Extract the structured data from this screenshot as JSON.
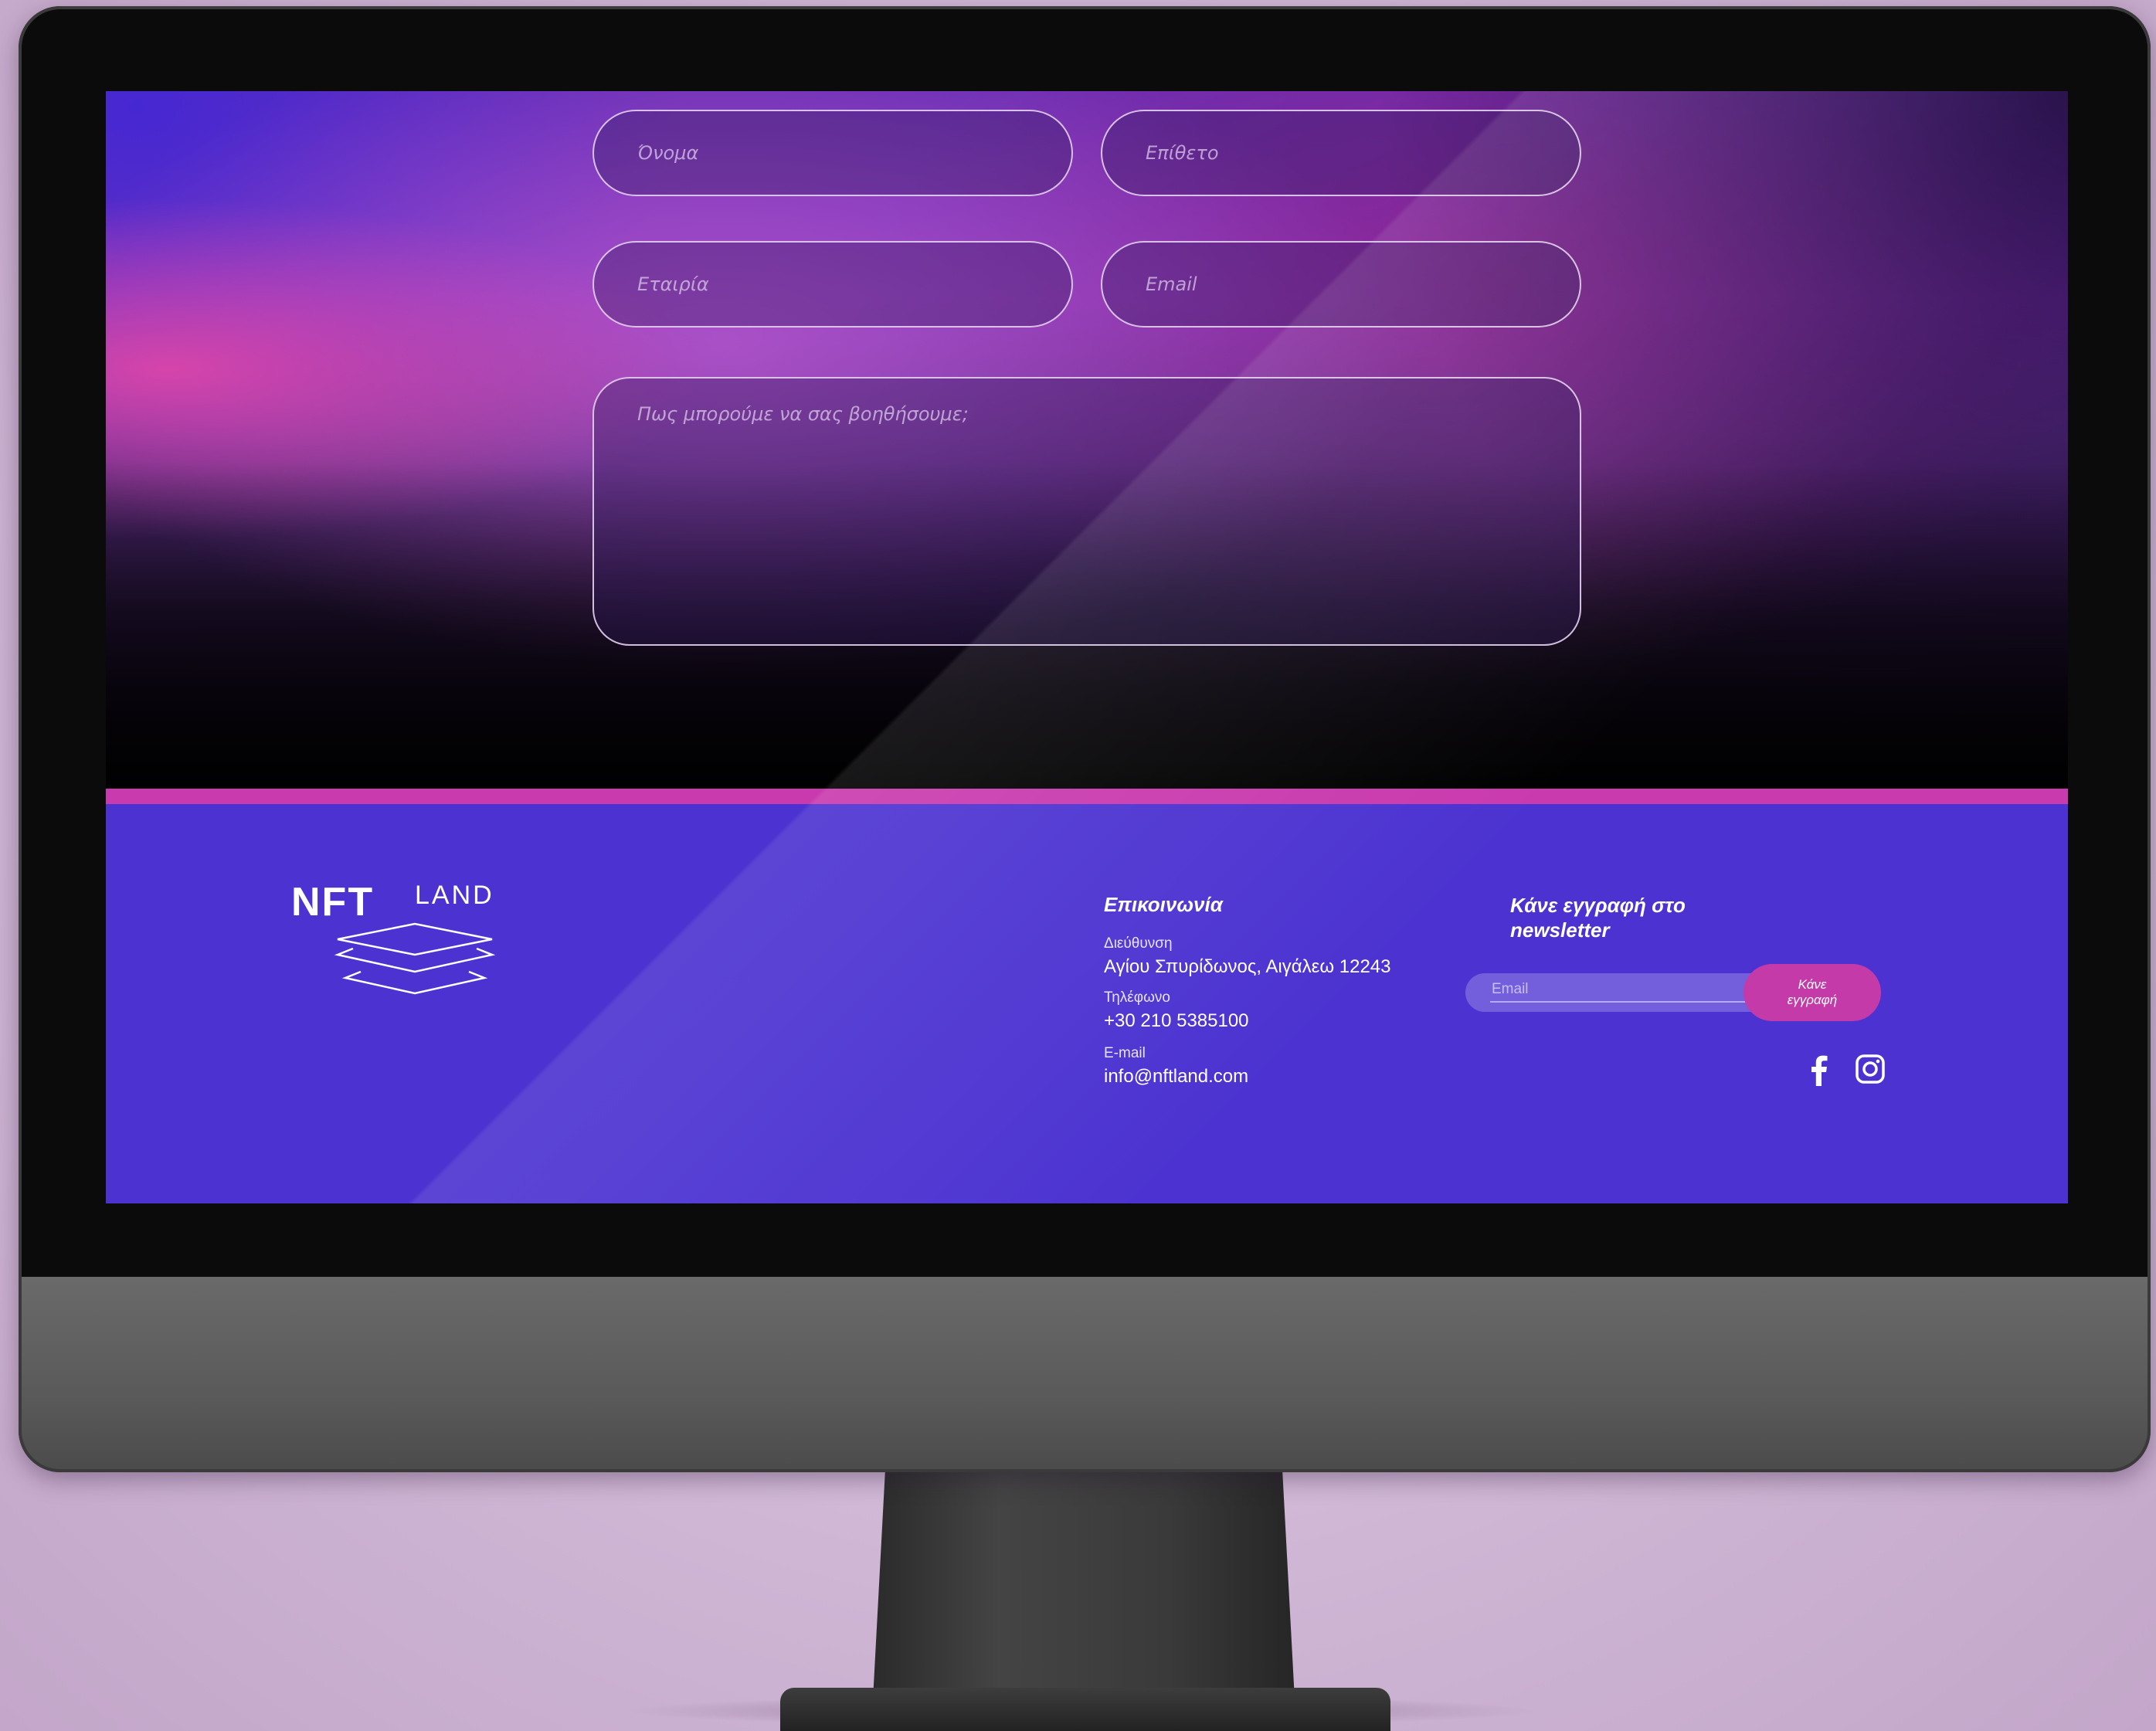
{
  "form": {
    "first_name_placeholder": "Όνομα",
    "last_name_placeholder": "Επίθετο",
    "company_placeholder": "Εταιρία",
    "email_placeholder": "Email",
    "message_placeholder": "Πως μπορούμε να σας βοηθήσουμε;"
  },
  "footer": {
    "logo_text_bold": "NFT",
    "logo_text_light": "LAND",
    "contact": {
      "title": "Επικοινωνία",
      "address_label": "Διεύθυνση",
      "address_value": "Αγίου Σπυρίδωνος, Αιγάλεω 12243",
      "phone_label": "Τηλέφωνο",
      "phone_value": "+30 210 5385100",
      "email_label": "E-mail",
      "email_value": "info@nftland.com"
    },
    "newsletter": {
      "title_line1": "Κάνε εγγραφή στο",
      "title_line2": "newsletter",
      "email_placeholder": "Email",
      "button_line1": "Κάνε",
      "button_line2": "εγγραφή"
    },
    "social_icons": [
      "facebook-icon",
      "instagram-icon"
    ]
  },
  "colors": {
    "footer_bg": "#4c33d1",
    "accent_pink": "#c93aae",
    "subscribe_button": "#c33aa8"
  }
}
